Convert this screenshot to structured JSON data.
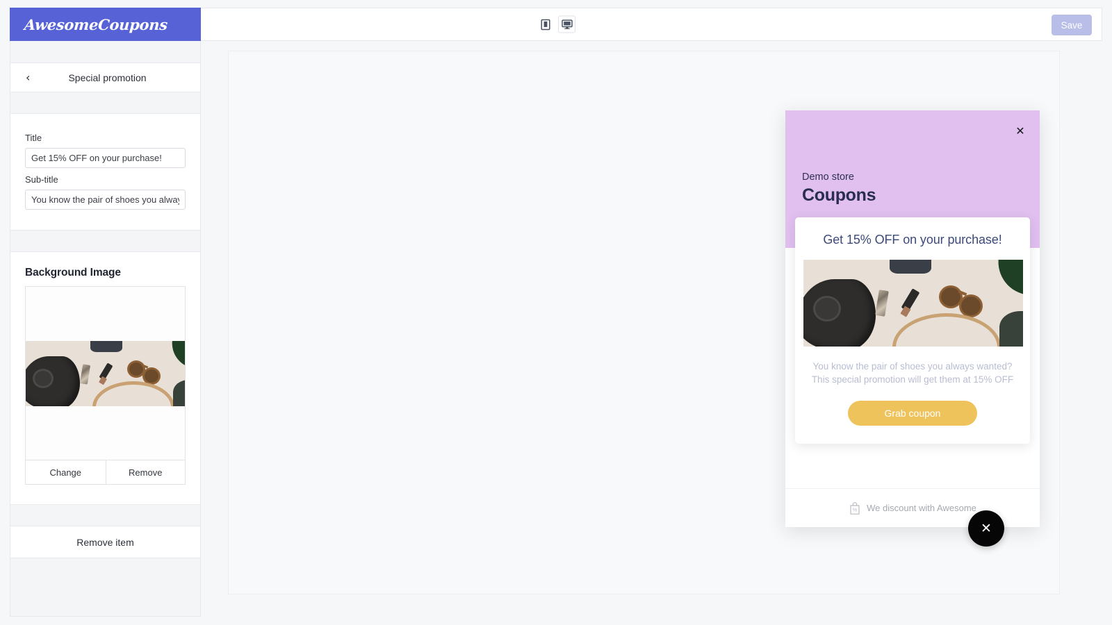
{
  "app": {
    "logo_text": "AwesomeCoupons"
  },
  "topbar": {
    "device_mobile_icon": "mobile-device-icon",
    "device_desktop_icon": "desktop-device-icon",
    "active_device": "desktop",
    "save_label": "Save"
  },
  "sidebar": {
    "back_icon": "chevron-left-icon",
    "panel_title": "Special promotion",
    "fields": [
      {
        "label": "Title",
        "value": "Get 15% OFF on your purchase!",
        "placeholder": "Title"
      },
      {
        "label": "Sub-title",
        "value": "You know the pair of shoes you alway",
        "placeholder": "Sub-title"
      }
    ],
    "image_section": {
      "title": "Background Image",
      "change_label": "Change",
      "remove_label": "Remove"
    },
    "remove_item_label": "Remove item"
  },
  "preview": {
    "close_icon": "close-x-icon",
    "store_name": "Demo store",
    "brand_name": "Coupons",
    "coupon_title": "Get 15% OFF on your purchase!",
    "coupon_subtitle_line1": "You know the pair of shoes you always wanted?",
    "coupon_subtitle_line2": "This special promotion will get them at 15% OFF",
    "grab_label": "Grab coupon",
    "footer_icon": "shopping-bag-percent-icon",
    "footer_text": "We discount with Awesome"
  },
  "fab": {
    "icon": "close-x-icon"
  },
  "colors": {
    "brand_blue": "#5662d6",
    "header_lilac": "#e1c0ef",
    "coupon_title_blue": "#3b4a7a",
    "grab_button_gold": "#eec35b",
    "save_disabled": "#b9bee9",
    "fab_black": "#060606"
  }
}
